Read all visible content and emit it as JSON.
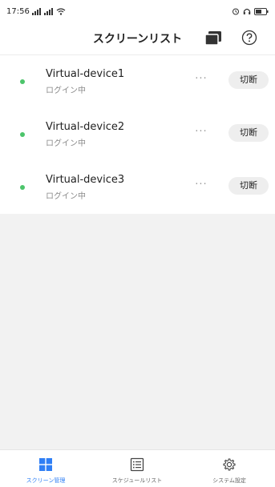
{
  "status_bar": {
    "time": "17:56",
    "signal_1": "4G",
    "signal_2": "4G"
  },
  "header": {
    "title": "スクリーンリスト",
    "screens_icon": "multi-screen-icon",
    "help_icon": "help-circle-icon"
  },
  "devices": [
    {
      "name": "Virtual-device1",
      "status": "ログイン中",
      "more": "···",
      "action": "切断"
    },
    {
      "name": "Virtual-device2",
      "status": "ログイン中",
      "more": "···",
      "action": "切断"
    },
    {
      "name": "Virtual-device3",
      "status": "ログイン中",
      "more": "···",
      "action": "切断"
    }
  ],
  "tabs": [
    {
      "label": "スクリーン管理",
      "icon": "grid-icon",
      "active": true
    },
    {
      "label": "スケジュールリスト",
      "icon": "list-icon",
      "active": false
    },
    {
      "label": "システム設定",
      "icon": "gear-icon",
      "active": false
    }
  ],
  "colors": {
    "accent": "#2f7ff5",
    "online_dot": "#4cc46b",
    "background": "#f2f2f2"
  }
}
